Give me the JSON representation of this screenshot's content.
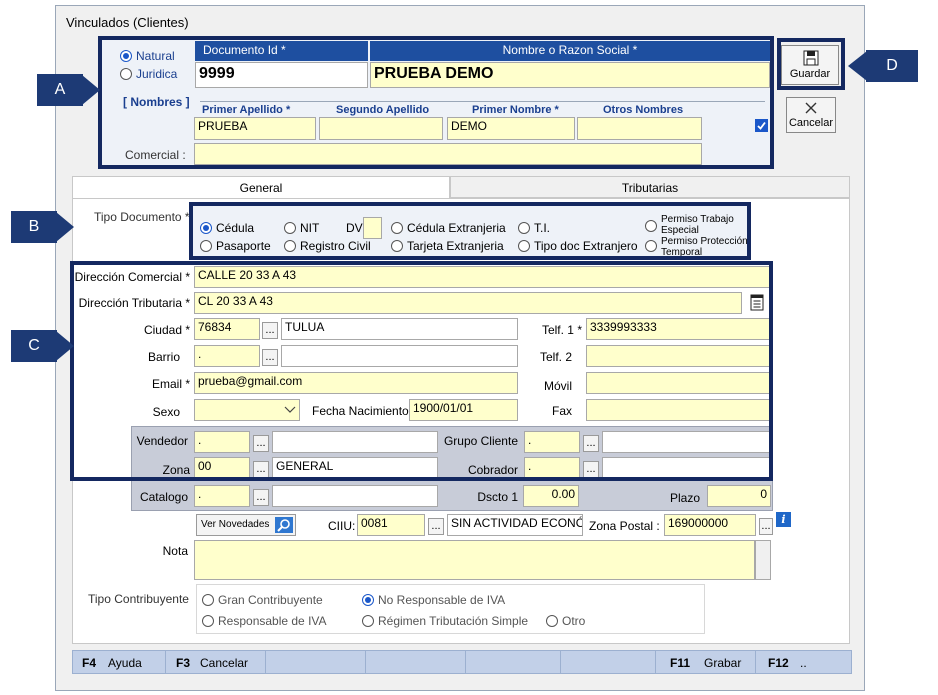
{
  "window": {
    "title": "Vinculados   (Clientes)"
  },
  "person_type": {
    "natural": "Natural",
    "juridica": "Juridica",
    "selected": "natural"
  },
  "headers": {
    "documento_id": "Documento Id *",
    "nombre": "Nombre  o  Razon Social *"
  },
  "fields": {
    "documento_id": "9999",
    "nombre": "PRUEBA DEMO",
    "primer_apellido": "PRUEBA",
    "segundo_apellido": "",
    "primer_nombre": "DEMO",
    "otros_nombres": "",
    "comercial": ""
  },
  "nombres": {
    "group_label": "[ Nombres ]",
    "primer_apellido": "Primer Apellido *",
    "segundo_apellido": "Segundo Apellido",
    "primer_nombre": "Primer Nombre *",
    "otros_nombres": "Otros Nombres",
    "comercial_label": "Comercial :"
  },
  "buttons": {
    "guardar": "Guardar",
    "cancelar": "Cancelar",
    "ver_novedades": "Ver Novedades"
  },
  "tabs": {
    "general": "General",
    "tributarias": "Tributarias",
    "active": "general"
  },
  "tipo_documento": {
    "label": "Tipo Documento *",
    "selected": "cedula",
    "cedula": "Cédula",
    "nit": "NIT",
    "dv_label": "DV",
    "cedula_extranjeria": "Cédula Extranjeria",
    "ti": "T.I.",
    "permiso_trabajo_1": "Permiso Trabajo",
    "permiso_trabajo_2": "Especial",
    "pasaporte": "Pasaporte",
    "registro_civil": "Registro Civil",
    "tarjeta_extranjeria": "Tarjeta Extranjeria",
    "tipo_doc_extranjero": "Tipo doc Extranjero",
    "permiso_proteccion_1": "Permiso Protección",
    "permiso_proteccion_2": "Temporal"
  },
  "contact": {
    "direccion_comercial_label": "Dirección Comercial *",
    "direccion_comercial": "CALLE 20 33 A 43",
    "direccion_tributaria_label": "Dirección Tributaria *",
    "direccion_tributaria": "CL 20 33 A 43",
    "ciudad_label": "Ciudad *",
    "ciudad_code": "76834",
    "ciudad_name": "TULUA",
    "telf1_label": "Telf. 1 *",
    "telf1": "3339993333",
    "barrio_label": "Barrio",
    "barrio_code": ".",
    "barrio_name": "",
    "telf2_label": "Telf. 2",
    "telf2": "",
    "email_label": "Email *",
    "email": "prueba@gmail.com",
    "movil_label": "Móvil",
    "movil": "",
    "sexo_label": "Sexo",
    "sexo": "",
    "fecha_nac_label": "Fecha Nacimiento",
    "fecha_nac": "1900/01/01",
    "fax_label": "Fax",
    "fax": ""
  },
  "commercial": {
    "vendedor_label": "Vendedor",
    "vendedor_code": ".",
    "vendedor_name": "",
    "grupo_cliente_label": "Grupo Cliente",
    "grupo_cliente_code": ".",
    "grupo_cliente_name": "",
    "zona_label": "Zona",
    "zona_code": "00",
    "zona_name": "GENERAL",
    "cobrador_label": "Cobrador",
    "cobrador_code": ".",
    "cobrador_name": "",
    "catalogo_label": "Catalogo",
    "catalogo_code": ".",
    "catalogo_name": "",
    "dscto1_label": "Dscto 1",
    "dscto1": "0.00",
    "plazo_label": "Plazo",
    "plazo": "0"
  },
  "misc": {
    "ciiu_label": "CIIU:",
    "ciiu_code": "0081",
    "ciiu_name": "SIN ACTIVIDAD ECONÓM",
    "zona_postal_label": "Zona Postal :",
    "zona_postal": "169000000",
    "nota_label": "Nota",
    "nota": ""
  },
  "tipo_contribuyente": {
    "label": "Tipo Contribuyente",
    "gran_contribuyente": "Gran Contribuyente",
    "no_responsable_iva": "No Responsable de IVA",
    "responsable_iva": "Responsable de IVA",
    "regimen_simple": "Régimen Tributación Simple",
    "otro": "Otro",
    "selected": "no_responsable_iva"
  },
  "status_bar": {
    "f4_key": "F4",
    "f4_label": "Ayuda",
    "f3_key": "F3",
    "f3_label": "Cancelar",
    "f11_key": "F11",
    "f11_label": "Grabar",
    "f12_key": "F12",
    "f12_label": ".."
  },
  "callouts": {
    "a": "A",
    "b": "B",
    "c": "C",
    "d": "D"
  },
  "colors": {
    "yellow_field": "#ffffcc",
    "header_blue": "#1e4fa0",
    "callout_navy": "#1d3a75",
    "radio_blue": "#1a57c9"
  }
}
